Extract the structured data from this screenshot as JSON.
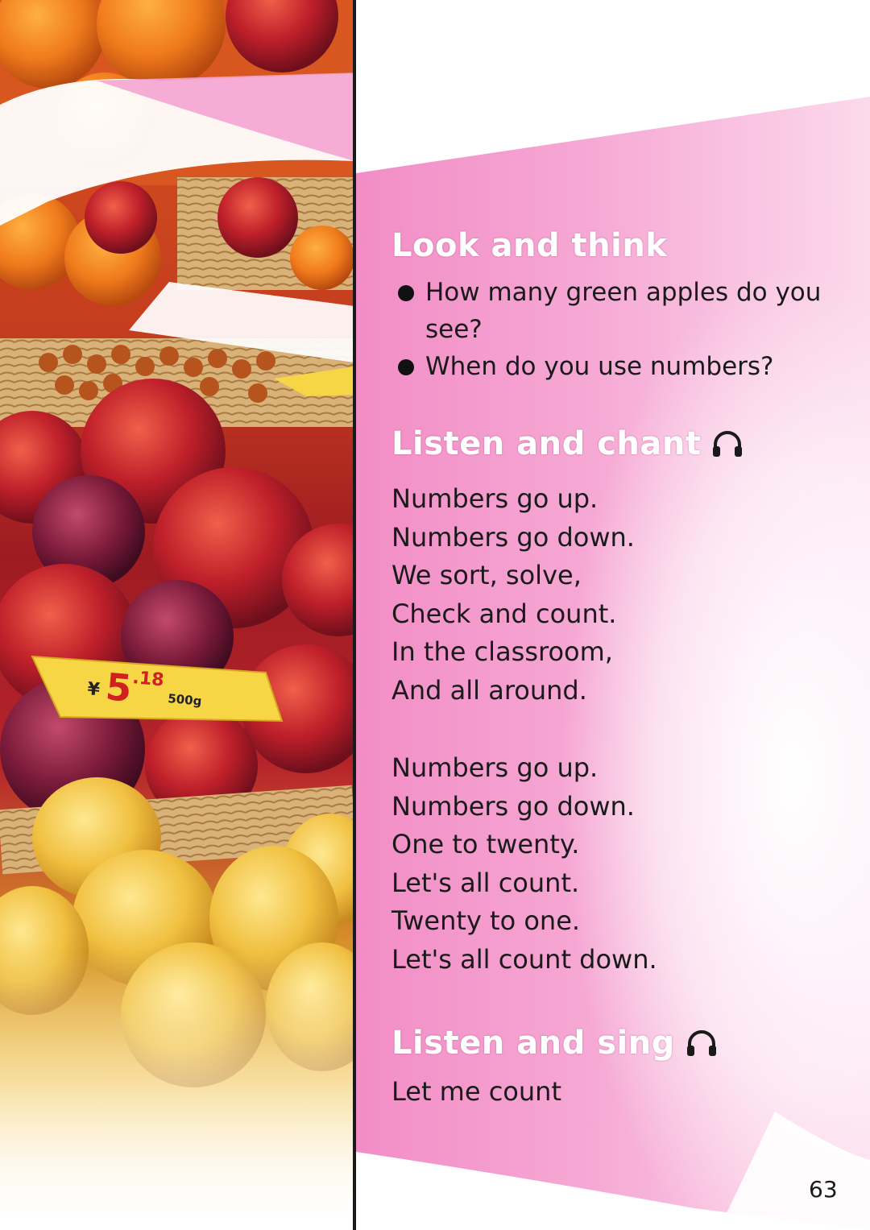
{
  "price_tag": {
    "currency": "¥",
    "integer": "5",
    "decimal": ".18",
    "weight": "500g"
  },
  "sections": {
    "look_and_think": {
      "title": "Look and think",
      "questions": [
        "How many green apples do you see?",
        "When do you use numbers?"
      ]
    },
    "listen_and_chant": {
      "title": "Listen and chant",
      "icon": "headphones-icon",
      "verse1": [
        "Numbers go up.",
        "Numbers go down.",
        "We sort, solve,",
        "Check and count.",
        "In the classroom,",
        "And all around."
      ],
      "verse2": [
        "Numbers go up.",
        "Numbers go down.",
        "One to twenty.",
        "Let's all count.",
        "Twenty to one.",
        "Let's all count down."
      ]
    },
    "listen_and_sing": {
      "title": "Listen and sing",
      "icon": "headphones-icon",
      "song_title": "Let me count"
    }
  },
  "page_number": "63",
  "colors": {
    "pink": "#f08cc4",
    "pink_light": "#fbd3ea",
    "apple_red": "#b5232a",
    "pear_yellow": "#f2c24a",
    "price_tag": "#f7d646"
  }
}
